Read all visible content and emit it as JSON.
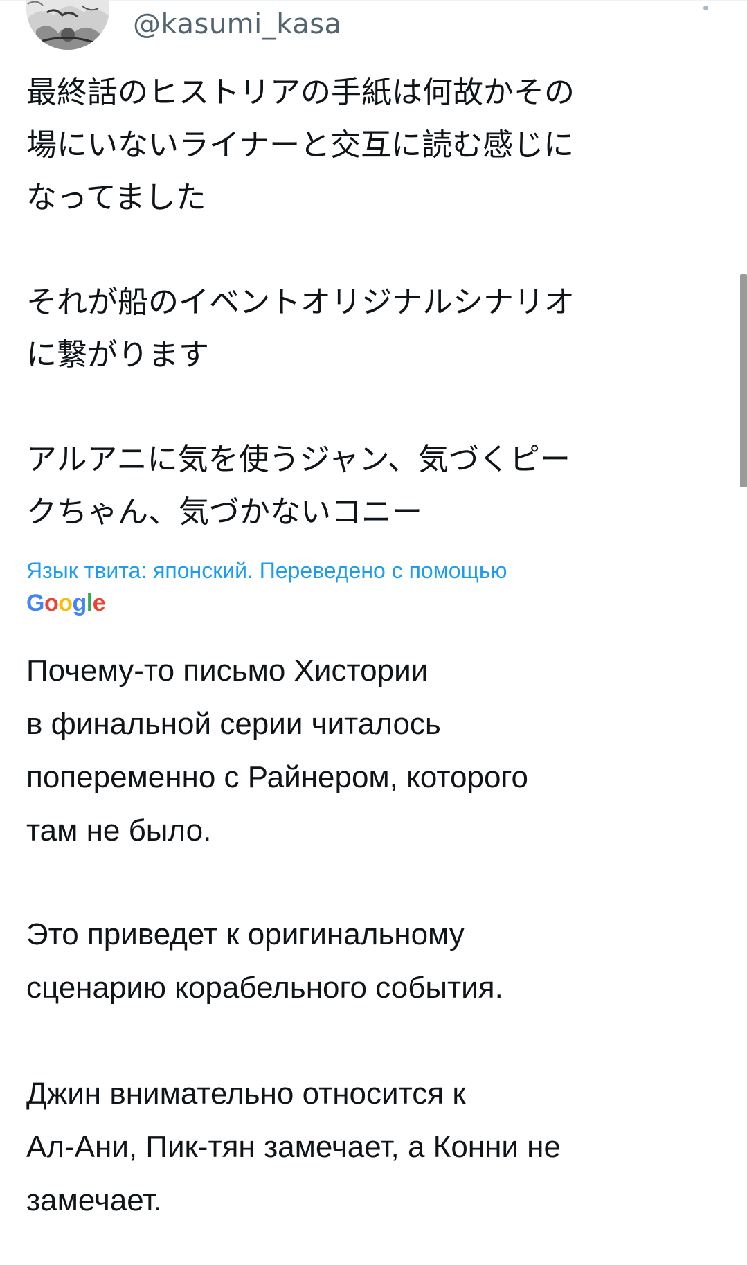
{
  "tweet": {
    "handle": "@kasumi_kasa",
    "original_paragraphs": [
      [
        "最終話のヒストリアの手紙は何故かその",
        "場にいないライナーと交互に読む感じに",
        "なってました"
      ],
      [
        "それが船のイベントオリジナルシナリオ",
        "に繋がります"
      ],
      [
        "アルアニに気を使うジャン、気づくピー",
        "クちゃん、気づかないコニー"
      ]
    ],
    "translation_note": "Язык твита: японский. Переведено с помощью",
    "translation_provider": {
      "letters": [
        "G",
        "o",
        "o",
        "g",
        "l",
        "e"
      ],
      "colors": [
        "#4285f4",
        "#ea4335",
        "#fbbc05",
        "#4285f4",
        "#34a853",
        "#ea4335"
      ]
    },
    "translated_paragraphs": [
      [
        "Почему-то письмо Хистории",
        "в финальной серии читалось",
        "попеременно с Райнером, которого",
        "там не было."
      ],
      [
        "Это приведет к оригинальному",
        "сценарию корабельного события."
      ],
      [
        "Джин внимательно относится к",
        "Ал-Ани, Пик-тян замечает, а Конни не",
        "замечает."
      ]
    ]
  },
  "colors": {
    "text": "#0f1419",
    "secondary": "#536471",
    "accent": "#1d9bf0"
  }
}
